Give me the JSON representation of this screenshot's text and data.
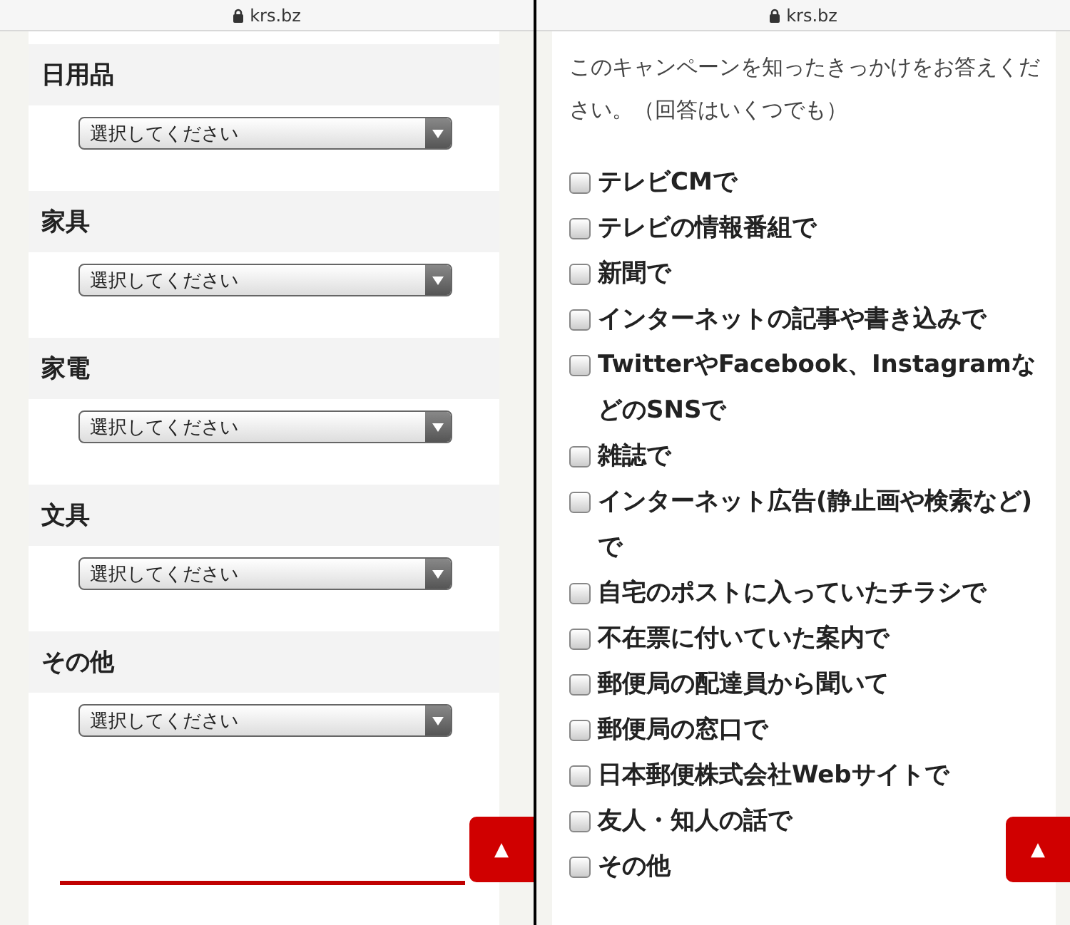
{
  "panes": [
    {
      "address": "krs.bz",
      "kind": "selects",
      "categories": [
        {
          "label": "日用品",
          "placeholder": "選択してください"
        },
        {
          "label": "家具",
          "placeholder": "選択してください"
        },
        {
          "label": "家電",
          "placeholder": "選択してください"
        },
        {
          "label": "文具",
          "placeholder": "選択してください"
        },
        {
          "label": "その他",
          "placeholder": "選択してください"
        }
      ],
      "scroll_top": "▲"
    },
    {
      "address": "krs.bz",
      "kind": "checks",
      "question": "このキャンペーンを知ったきっかけをお答えください。（回答はいくつでも）",
      "options": [
        {
          "label": "テレビCMで",
          "checked": false
        },
        {
          "label": "テレビの情報番組で",
          "checked": false
        },
        {
          "label": "新聞で",
          "checked": false
        },
        {
          "label": "インターネットの記事や書き込みで",
          "checked": false
        },
        {
          "label": "TwitterやFacebook、InstagramなどのSNSで",
          "checked": false
        },
        {
          "label": "雑誌で",
          "checked": false
        },
        {
          "label": "インターネット広告(静止画や検索など)で",
          "checked": false
        },
        {
          "label": "自宅のポストに入っていたチラシで",
          "checked": false
        },
        {
          "label": "不在票に付いていた案内で",
          "checked": false
        },
        {
          "label": "郵便局の配達員から聞いて",
          "checked": false
        },
        {
          "label": "郵便局の窓口で",
          "checked": false
        },
        {
          "label": "日本郵便株式会社Webサイトで",
          "checked": false
        },
        {
          "label": "友人・知人の話で",
          "checked": false
        },
        {
          "label": "その他",
          "checked": false
        }
      ],
      "scroll_top": "▲"
    }
  ]
}
